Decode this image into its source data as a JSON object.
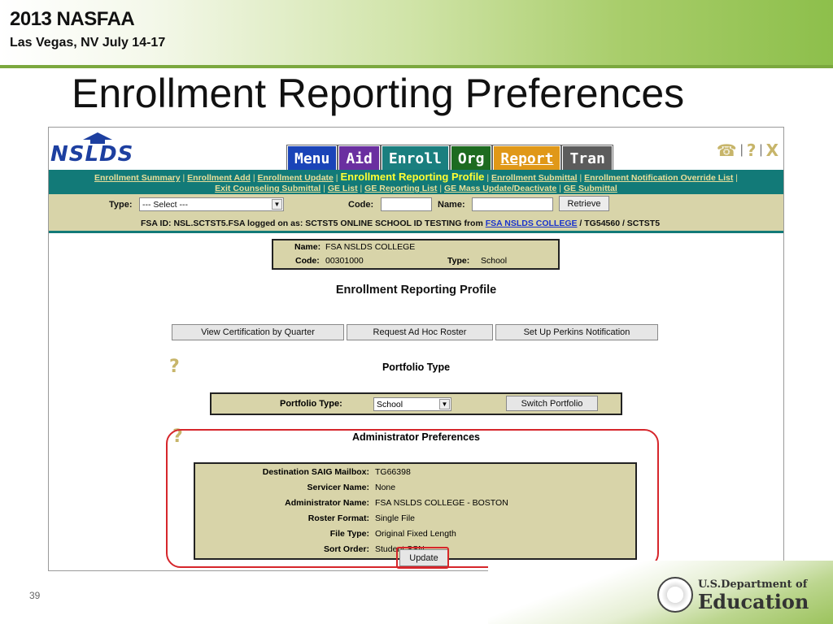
{
  "slide": {
    "conference_title": "2013 NASFAA",
    "conference_location": "Las Vegas, NV July 14-17",
    "title": "Enrollment Reporting Preferences",
    "page_number": "39",
    "footer_org_line1": "U.S.Department of",
    "footer_org_line2": "Education"
  },
  "app": {
    "logo": "NSLDS",
    "tabs": [
      "Menu",
      "Aid",
      "Enroll",
      "Org",
      "Report",
      "Tran"
    ],
    "top_icons": [
      "phone-icon",
      "help-icon",
      "close-icon"
    ],
    "top_icon_glyphs": [
      "☎",
      "?",
      "X"
    ],
    "subnav": {
      "links_row1": [
        "Enrollment Summary",
        "Enrollment Add",
        "Enrollment Update"
      ],
      "current": "Enrollment Reporting Profile",
      "links_row1b": [
        "Enrollment Submittal",
        "Enrollment Notification Override List"
      ],
      "links_row2": [
        "Exit Counseling Submittal",
        "GE List",
        "GE Reporting List",
        "GE Mass Update/Deactivate",
        "GE Submittal"
      ]
    },
    "search": {
      "type_label": "Type:",
      "type_value": "--- Select ---",
      "code_label": "Code:",
      "code_value": "",
      "name_label": "Name:",
      "name_value": "",
      "retrieve_label": "Retrieve"
    },
    "login": {
      "prefix": "FSA ID: NSL.SCTST5.FSA logged on as: SCTST5 ONLINE SCHOOL ID TESTING from ",
      "school_link": "FSA NSLDS COLLEGE",
      "suffix": " / TG54560 / SCTST5"
    },
    "school": {
      "name_label": "Name:",
      "name": "FSA NSLDS COLLEGE",
      "code_label": "Code:",
      "code": "00301000",
      "type_label": "Type:",
      "type": "School"
    },
    "profile_title": "Enrollment Reporting Profile",
    "action_buttons": [
      "View Certification by Quarter",
      "Request Ad Hoc Roster",
      "Set Up Perkins Notification"
    ],
    "portfolio": {
      "title": "Portfolio Type",
      "label": "Portfolio Type:",
      "value": "School",
      "switch_label": "Switch Portfolio"
    },
    "admin": {
      "title": "Administrator Preferences",
      "rows": [
        {
          "label": "Destination SAIG Mailbox:",
          "value": "TG66398"
        },
        {
          "label": "Servicer Name:",
          "value": "None"
        },
        {
          "label": "Administrator Name:",
          "value": "FSA NSLDS COLLEGE - BOSTON"
        },
        {
          "label": "Roster Format:",
          "value": "Single File"
        },
        {
          "label": "File Type:",
          "value": "Original Fixed Length"
        },
        {
          "label": "Sort Order:",
          "value": "Student SSN"
        }
      ],
      "update_label": "Update"
    },
    "colors": {
      "accent_teal": "#127a78",
      "panel_tan": "#d8d4a9",
      "highlight_red": "#d6262b"
    }
  }
}
